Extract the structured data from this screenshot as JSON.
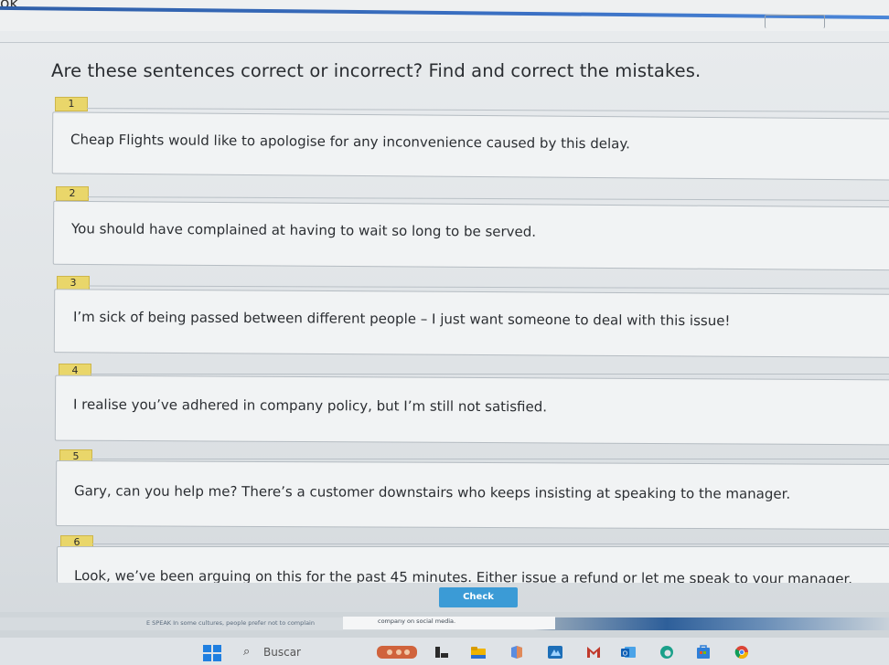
{
  "header": {
    "corner_text": "ok"
  },
  "instruction": "Are these sentences correct or incorrect? Find and correct the mistakes.",
  "items": [
    {
      "number": "1",
      "sentence": "Cheap Flights would like to apologise for any inconvenience caused by this delay."
    },
    {
      "number": "2",
      "sentence": "You should have complained at having to wait so long to be served."
    },
    {
      "number": "3",
      "sentence": "I’m sick of being passed between different people – I just want someone to deal with this issue!"
    },
    {
      "number": "4",
      "sentence": "I realise you’ve adhered in company policy, but I’m still not satisfied."
    },
    {
      "number": "5",
      "sentence": "Gary, can you help me? There’s a customer downstairs who keeps insisting at speaking to the manager."
    },
    {
      "number": "6",
      "sentence": "Look, we’ve been arguing on this for the past 45 minutes. Either issue a refund or let me speak to your manager."
    }
  ],
  "check_button": "Check",
  "footer": {
    "speak_text": "E SPEAK In some cultures, people prefer not to complain",
    "social_text": "company on social media."
  },
  "taskbar": {
    "search_placeholder": "Buscar",
    "icons": [
      "windows-icon",
      "search-icon",
      "widgets-icon",
      "task-view-icon",
      "file-explorer-icon",
      "copilot-icon",
      "photos-icon",
      "malwarebytes-icon",
      "outlook-icon",
      "edge-icon",
      "store-icon",
      "chrome-icon"
    ]
  },
  "colors": {
    "badge": "#e9d66a",
    "check_button": "#3b9bd6",
    "accent_rule": "#2f5fa8",
    "windows_blue": "#1f7fe0"
  }
}
